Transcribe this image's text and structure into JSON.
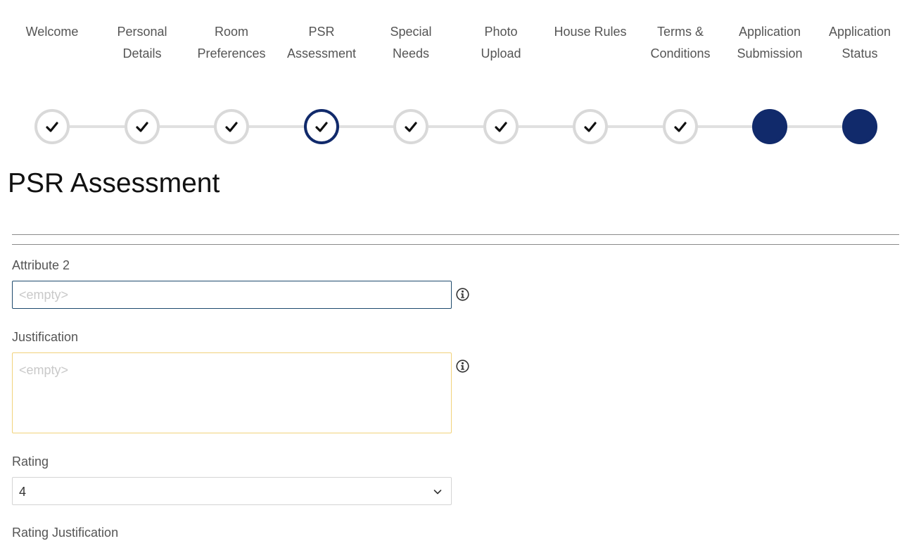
{
  "stepper": {
    "steps": [
      {
        "label_line1": "Welcome",
        "label_line2": "",
        "state": "completed"
      },
      {
        "label_line1": "Personal",
        "label_line2": "Details",
        "state": "completed"
      },
      {
        "label_line1": "Room",
        "label_line2": "Preferences",
        "state": "completed"
      },
      {
        "label_line1": "PSR",
        "label_line2": "Assessment",
        "state": "active"
      },
      {
        "label_line1": "Special",
        "label_line2": "Needs",
        "state": "completed"
      },
      {
        "label_line1": "Photo",
        "label_line2": "Upload",
        "state": "completed"
      },
      {
        "label_line1": "House Rules",
        "label_line2": "",
        "state": "completed"
      },
      {
        "label_line1": "Terms &",
        "label_line2": "Conditions",
        "state": "completed"
      },
      {
        "label_line1": "Application",
        "label_line2": "Submission",
        "state": "pending"
      },
      {
        "label_line1": "Application",
        "label_line2": "Status",
        "state": "pending"
      }
    ],
    "colors": {
      "active": "#112a6b",
      "pending": "#112a6b",
      "completed_ring": "#d9d9d9",
      "connector": "#e0e0e0"
    },
    "icons": {
      "completed": "check-icon"
    }
  },
  "page": {
    "title": "PSR Assessment"
  },
  "form": {
    "attribute2": {
      "label": "Attribute 2",
      "value": "",
      "placeholder": "<empty>",
      "info_icon": "info-icon"
    },
    "justification": {
      "label": "Justification",
      "value": "",
      "placeholder": "<empty>",
      "info_icon": "info-icon"
    },
    "rating": {
      "label": "Rating",
      "selected": "4",
      "dropdown_icon": "chevron-down-icon"
    },
    "rating_justification": {
      "label": "Rating Justification"
    }
  }
}
